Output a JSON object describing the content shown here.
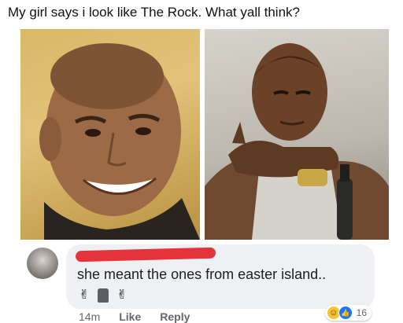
{
  "post": {
    "caption": "My girl says i look like The Rock. What yall think?"
  },
  "photos": {
    "left_icon": "portrait-photo",
    "right_icon": "portrait-photo"
  },
  "comment": {
    "avatar_icon": "avatar-icon",
    "author_name": "",
    "text": "she meant the ones from easter island..",
    "emojis": [
      "victory-hand-icon",
      "moai-icon",
      "victory-hand-icon"
    ],
    "emoji_glyphs": [
      "✌",
      "",
      "✌"
    ],
    "reactions": {
      "types": [
        "haha-icon",
        "like-icon"
      ],
      "count": "16"
    },
    "actions": {
      "time": "14m",
      "like_label": "Like",
      "reply_label": "Reply"
    },
    "colors": {
      "bubble": "#eef0f3",
      "redaction": "#e4333a",
      "like_blue": "#1877f2",
      "haha_yellow": "#f7c333"
    }
  }
}
